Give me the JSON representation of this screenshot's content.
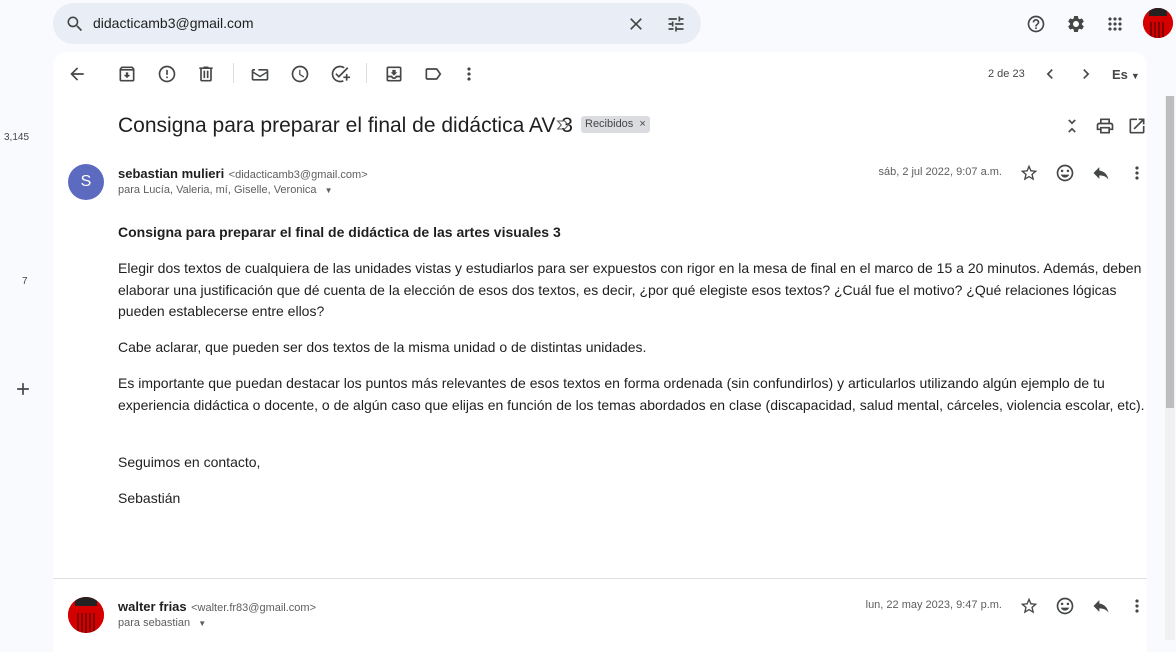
{
  "search": {
    "value": "didacticamb3@gmail.com"
  },
  "rail": {
    "count_top": "3,145",
    "count_mid": "7"
  },
  "toolbar": {
    "pagination": "2 de 23",
    "lang": "Es"
  },
  "thread": {
    "subject": "Consigna para preparar el final de didáctica AV 3",
    "label": "Recibidos",
    "label_close": "×"
  },
  "message1": {
    "avatar_letter": "S",
    "sender_name": "sebastian mulieri",
    "sender_email": "<didacticamb3@gmail.com>",
    "to": "para Lucía, Valeria, mí, Giselle, Veronica",
    "date": "sáb, 2 jul 2022, 9:07 a.m.",
    "title": "Consigna para preparar el final de didáctica de las artes visuales 3",
    "p1": "Elegir dos textos de cualquiera de las unidades vistas y estudiarlos para ser expuestos con rigor en la mesa de final en el marco de 15 a 20 minutos. Además, deben elaborar una justificación que dé cuenta de la elección de esos dos textos, es decir, ¿por qué elegiste esos textos? ¿Cuál fue el motivo? ¿Qué relaciones lógicas pueden establecerse entre ellos?",
    "p2": "Cabe aclarar, que pueden ser dos textos de la misma unidad o de distintas unidades.",
    "p3": "Es importante que puedan destacar los puntos más relevantes de esos textos en forma ordenada (sin confundirlos) y  articularlos  utilizando algún ejemplo de tu experiencia didáctica o docente, o de algún caso que elijas en función de los temas abordados en clase (discapacidad, salud mental, cárceles, violencia escolar, etc).",
    "p4": "Seguimos en contacto,",
    "p5": "Sebastián"
  },
  "message2": {
    "sender_name": "walter frias",
    "sender_email": "<walter.fr83@gmail.com>",
    "to": "para sebastian",
    "date": "lun, 22 may 2023, 9:47 p.m."
  }
}
